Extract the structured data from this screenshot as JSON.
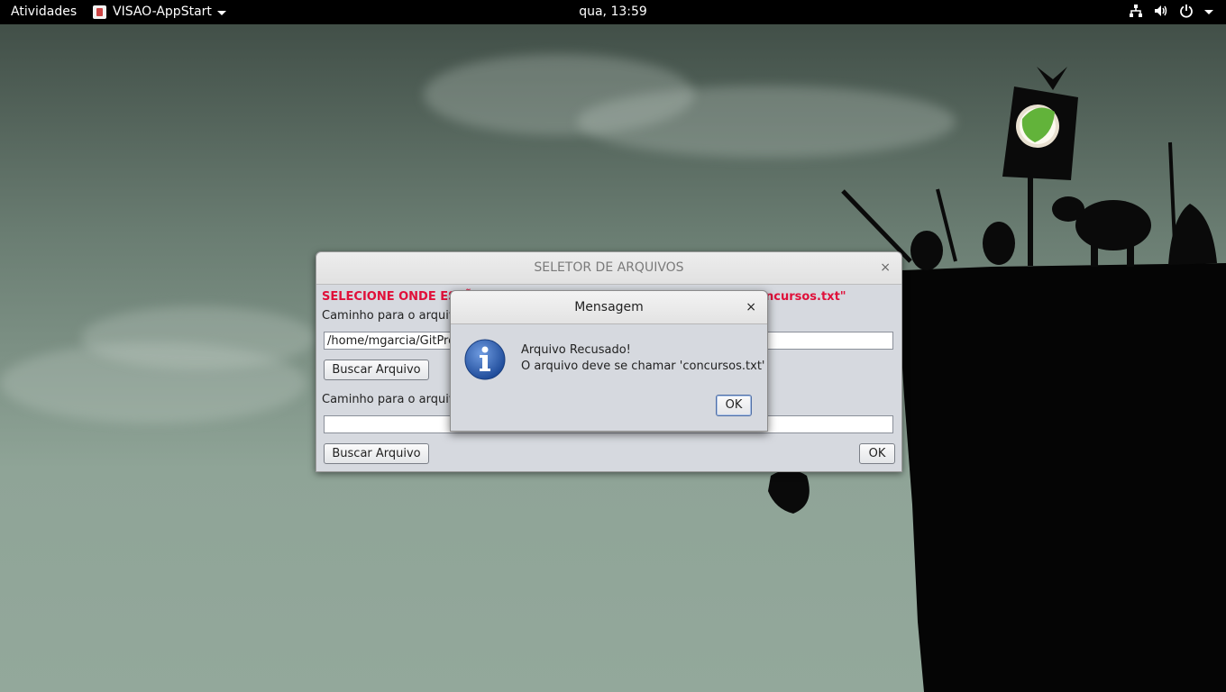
{
  "topbar": {
    "activities": "Atividades",
    "app_name": "VISAO-AppStart",
    "clock": "qua, 13:59",
    "icons": [
      "network-icon",
      "volume-icon",
      "power-icon",
      "chevron-down-icon"
    ]
  },
  "main_window": {
    "title": "SELETOR DE ARQUIVOS",
    "close_glyph": "×",
    "warning_visible_left": "SELECIONE ONDE ESTÃ",
    "warning_visible_right": "ncursos.txt\"",
    "label_1": "Caminho para o arquivo",
    "field_1_value": "/home/mgarcia/GitProj",
    "browse_1_label": "Buscar Arquivo",
    "label_2": "Caminho para o arquivo",
    "field_2_value": "",
    "browse_2_label": "Buscar Arquivo",
    "ok_label": "OK"
  },
  "dialog": {
    "title": "Mensagem",
    "close_glyph": "×",
    "icon": "info-icon",
    "message_line1": "Arquivo Recusado!",
    "message_line2": "O arquivo deve se chamar 'concursos.txt'",
    "ok_label": "OK"
  },
  "colors": {
    "warning_text": "#e0103a",
    "window_bg": "#d6d9df",
    "topbar_bg": "#000000",
    "info_icon": "#2f5fb0"
  }
}
